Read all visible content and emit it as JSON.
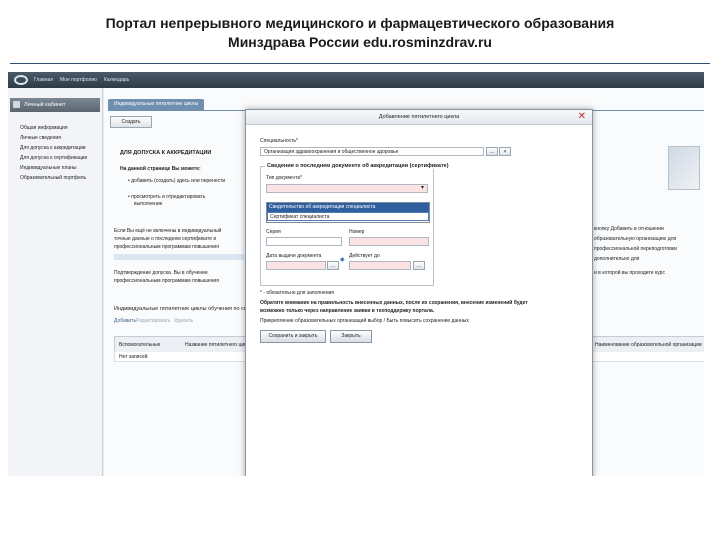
{
  "slide": {
    "title_line1": "Портал непрерывного медицинского и фармацевтического образования",
    "title_line2": "Минздрава России edu.rosminzdrav.ru"
  },
  "topbar": {
    "nav": [
      "Главная",
      "Мое портфолио",
      "Календарь"
    ]
  },
  "sidebar": {
    "header": "Личный кабинет",
    "items": [
      "Общая информация",
      "Личные сведения",
      "Для допуска к аккредитации",
      "Для допуска к сертификации",
      "Индивидуальные планы",
      "Образовательный портфель"
    ]
  },
  "main": {
    "tab": "Индивидуальные пятилетние циклы",
    "create_button": "Создать",
    "section_title": "ДЛЯ ДОПУСКА К АККРЕДИТАЦИИ",
    "subtitle": "На данной странице Вы можете:",
    "bullet1": "• добавить (создать) здесь или перенести",
    "bullet2": "• просмотреть и отредактировать",
    "bullet2b": "выполнение",
    "para1": "Если Вы ещё не включены в индивидуальный",
    "para1b": "точные данные о последнем сертификате и",
    "para1c": "профессиональным программам повышения",
    "para1d": "Подтверждение допуска. Вы в обучение",
    "para1e": "профессиональным программам повышения",
    "right1": "кнопку Добавить в отношении",
    "right2": "образовательную организацию для",
    "right3": "профессиональной переподготовки",
    "right4": "дополнительно для",
    "right5": "и в которой вы проходите курс",
    "grid_title": "Индивидуальные пятилетние циклы обучения по специальности",
    "grid_actions": [
      "Добавить",
      "Редактировать",
      "Удалить"
    ],
    "grid_col1": "Вспомогательные",
    "grid_col2": "Название пятилетнего цикла",
    "grid_col3": "Наименование образовательной организации",
    "grid_empty": "Нет записей"
  },
  "modal": {
    "title": "Добавление пятилетнего цикла",
    "specialty_label": "Специальность*",
    "specialty_value": "Организация здравоохранения и общественное здоровье",
    "fieldset_legend": "Сведения о последнем документе об аккредитации (сертификате)",
    "doc_type_label": "Тип документа*",
    "doc_type_value": "",
    "options": [
      "Свидетельство об аккредитации специалиста",
      "Сертификат специалиста"
    ],
    "series_label": "Серия",
    "number_label": "Номер",
    "issue_date_label": "Дата выдачи документа",
    "valid_until_label": "Действует до",
    "required_note": "* - обязательно для заполнения",
    "warning1": "Обратите внимание на правильность внесенных данных, после их сохранения, внесение изменений будет",
    "warning2": "возможно только через направление заявки в техподдержку портала.",
    "info": "Прикрепление образовательных организаций выбор / Быть повысить сохранение данных",
    "save_button": "Сохранить и закрыть",
    "close_button": "Закрыть",
    "ellipsis": "...",
    "clear": "×"
  }
}
